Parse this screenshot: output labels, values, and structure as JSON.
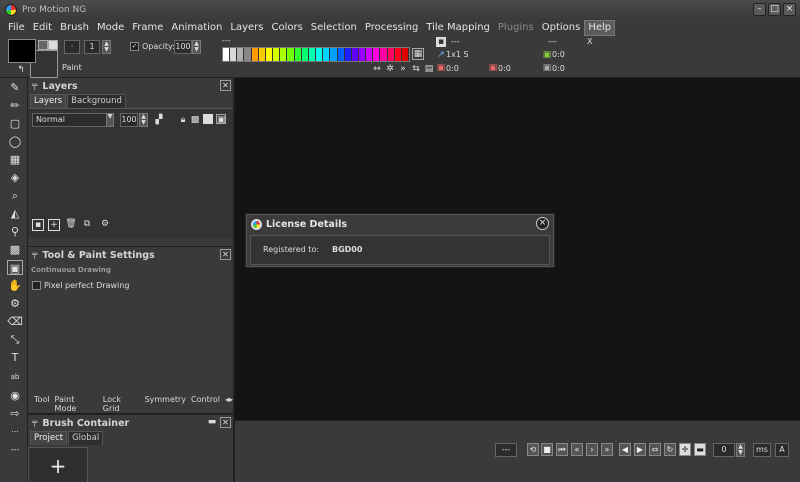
{
  "window": {
    "title": "Pro Motion NG",
    "minimize": "–",
    "maximize": "□",
    "close": "×"
  },
  "menu": [
    "File",
    "Edit",
    "Brush",
    "Mode",
    "Frame",
    "Animation",
    "Layers",
    "Colors",
    "Selection",
    "Processing",
    "Tile Mapping",
    "Plugins",
    "Options",
    "Help"
  ],
  "toolbar": {
    "brush_size": "1",
    "opacity_label": "Opacity:",
    "opacity_value": "100",
    "paint_label": "Paint",
    "dash1": "---",
    "dash2": "---",
    "brush_dims": "1x1 S",
    "tile_x": "---",
    "x_label": "X",
    "coord_a": "0:0",
    "coord_b": "0:0",
    "coord_c": "0:0",
    "coord_d": "0:0",
    "palette_colors": [
      "#ffffff",
      "#d8d8d8",
      "#b0b0b0",
      "#888888",
      "#ff9a00",
      "#ffcc00",
      "#ffff00",
      "#d8ff00",
      "#a8ff00",
      "#70ff00",
      "#30ff30",
      "#00ff70",
      "#00ffb0",
      "#00ffe8",
      "#00d8ff",
      "#00a0ff",
      "#0060ff",
      "#2020ff",
      "#6000ff",
      "#9a00ff",
      "#d000ff",
      "#ff00e0",
      "#ff00a0",
      "#ff0060",
      "#ff0020",
      "#e00000"
    ]
  },
  "layers_panel": {
    "title": "Layers",
    "tabs": [
      "Layers",
      "Background"
    ],
    "blend_mode": "Normal",
    "opacity": "100"
  },
  "tool_panel": {
    "title": "Tool & Paint Settings",
    "subtitle": "Continuous Drawing",
    "pixel_perfect": "Pixel perfect Drawing",
    "bottom_tabs": [
      "Tool",
      "Paint Mode",
      "Lock Grid",
      "Symmetry",
      "Control"
    ]
  },
  "brush_panel": {
    "title": "Brush Container",
    "tabs": [
      "Project",
      "Global"
    ],
    "add": "+"
  },
  "left_more": "...",
  "bottom_left": "---",
  "anim": {
    "dash": "---",
    "frame": "0",
    "ms": "ms",
    "a": "A"
  },
  "dialog": {
    "title": "License Details",
    "label": "Registered to:",
    "value": "BGD00"
  }
}
